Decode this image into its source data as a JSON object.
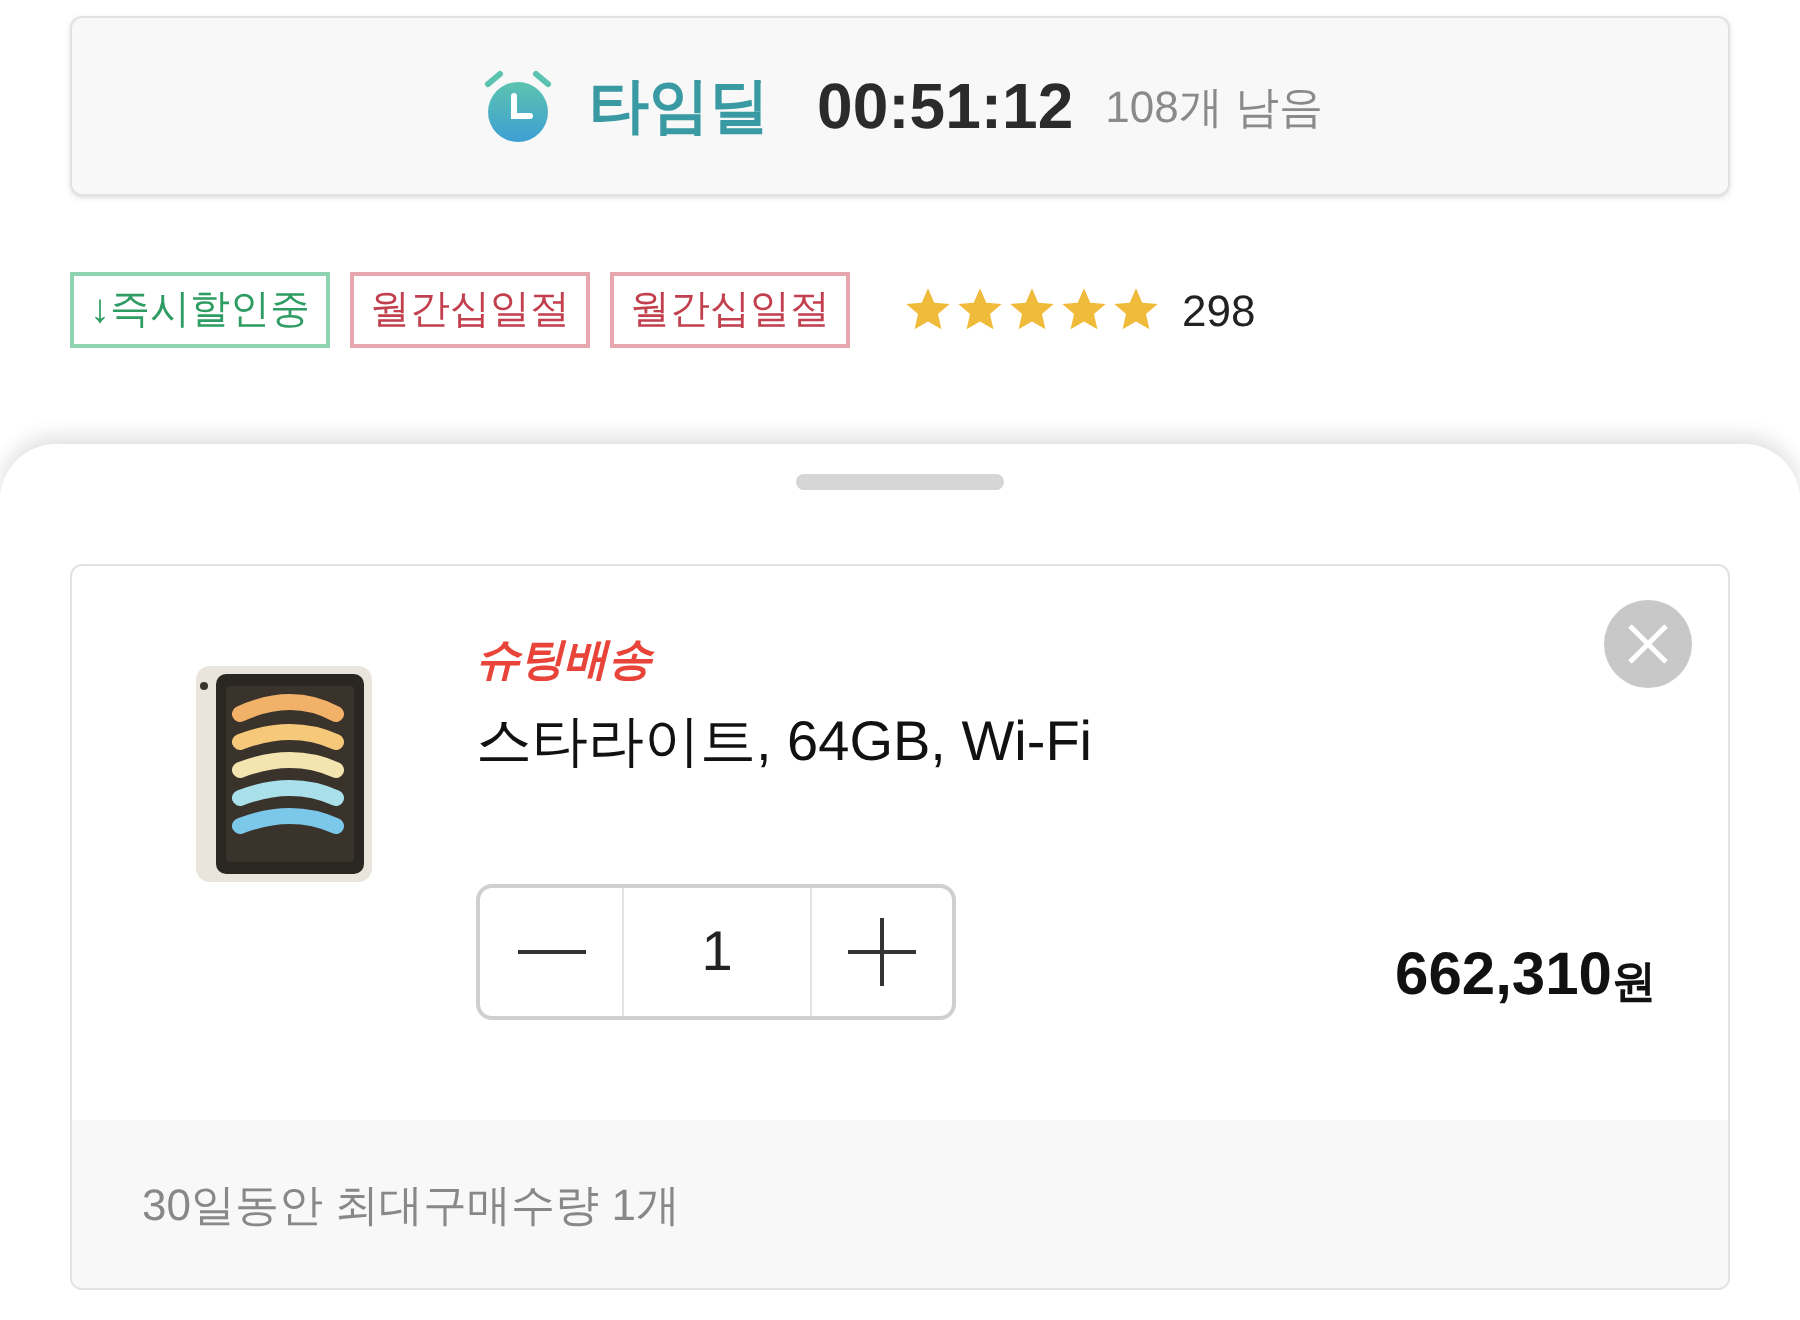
{
  "timer": {
    "title": "타임딜",
    "time": "00:51:12",
    "remaining": "108개 남음"
  },
  "tags": [
    {
      "label": "↓즉시할인중",
      "kind": "discount"
    },
    {
      "label": "월간십일절",
      "kind": "event"
    },
    {
      "label": "월간십일절",
      "kind": "event"
    }
  ],
  "rating": {
    "stars": 5,
    "count": "298"
  },
  "sheet": {
    "item": {
      "kind": "picture",
      "delivery": "슈팅배송",
      "option": "스타라이트, 64GB, Wi-Fi",
      "quantity": "1",
      "price": "662,310",
      "currency": "원"
    },
    "notice": "30일동안 최대구매수량 1개"
  }
}
